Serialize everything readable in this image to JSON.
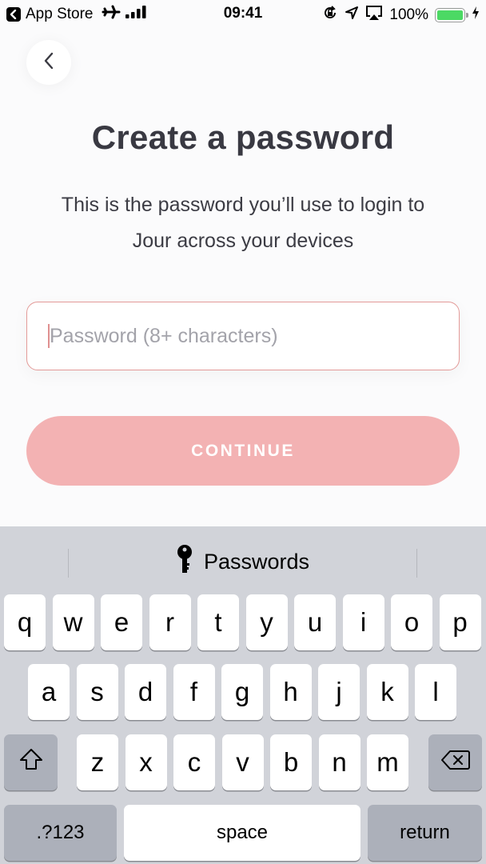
{
  "status_bar": {
    "back_app_label": "App Store",
    "time": "09:41",
    "battery_percent_label": "100%",
    "battery_level": 1.0,
    "icons": [
      "back-arrow-icon",
      "airplane-icon",
      "signal-icon",
      "rotation-lock-icon",
      "location-icon",
      "airplay-icon",
      "battery-icon",
      "charging-bolt-icon"
    ],
    "battery_color": "#4cd964"
  },
  "header": {
    "back_icon": "chevron-left-icon"
  },
  "main": {
    "title": "Create a password",
    "subtitle_line1": "This is the password you’ll use to login to",
    "subtitle_line2": "Jour across your devices",
    "password_field": {
      "value": "",
      "placeholder": "Password (8+ characters)"
    },
    "continue_label": "CONTINUE",
    "accent_color": "#f3b2b3",
    "field_border_color": "#e39a98"
  },
  "keyboard": {
    "quicktype": {
      "icon": "key-icon",
      "label": "Passwords"
    },
    "row1": [
      "q",
      "w",
      "e",
      "r",
      "t",
      "y",
      "u",
      "i",
      "o",
      "p"
    ],
    "row2": [
      "a",
      "s",
      "d",
      "f",
      "g",
      "h",
      "j",
      "k",
      "l"
    ],
    "row3": [
      "z",
      "x",
      "c",
      "v",
      "b",
      "n",
      "m"
    ],
    "shift_icon": "shift-icon",
    "delete_icon": "backspace-icon",
    "numbers_label": ".?123",
    "space_label": "space",
    "return_label": "return"
  }
}
